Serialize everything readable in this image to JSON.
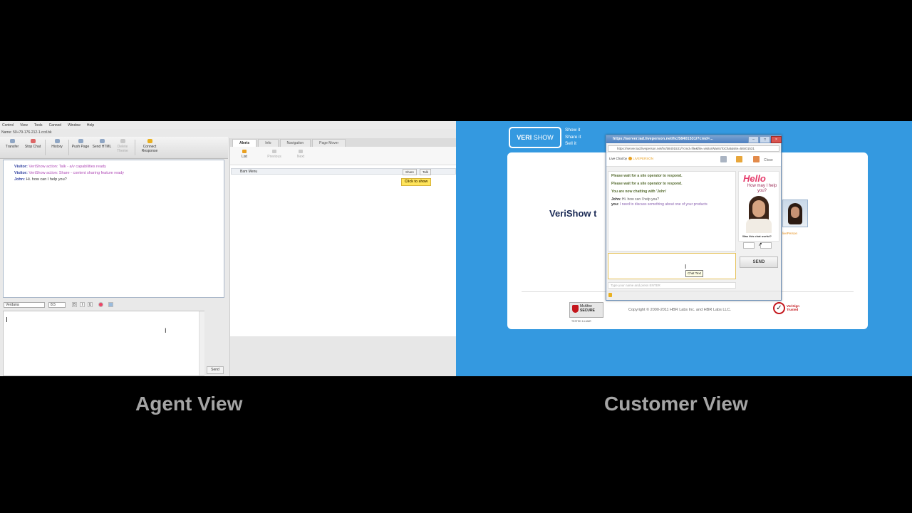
{
  "agent": {
    "menu": [
      "Control",
      "View",
      "Tools",
      "Canned",
      "Window",
      "Help"
    ],
    "name_line": "Name: 50+79-176-212-1.ccd.bk",
    "toolbar": [
      {
        "label": "Transfer",
        "enabled": true
      },
      {
        "label": "Stop Chat",
        "enabled": true
      },
      {
        "label": "History",
        "enabled": true
      },
      {
        "label": "Push Page",
        "enabled": true
      },
      {
        "label": "Send HTML",
        "enabled": true
      },
      {
        "label": "Delete Theme",
        "enabled": false
      },
      {
        "label": "Connect Response",
        "enabled": true
      }
    ],
    "chat": [
      {
        "who": "Visitor:",
        "text": "VeriShow action: Talk - a/v capabilities ready"
      },
      {
        "who": "Visitor:",
        "text": "VeriShow action: Share - content sharing feature ready"
      },
      {
        "who": "John:",
        "text": "Hi. how can I help you?"
      }
    ],
    "format": {
      "font": "Verdana",
      "size": "8.5"
    },
    "send_label": "Send",
    "right_tabs": [
      "Alerts",
      "Info",
      "Navigation",
      "Page Mover"
    ],
    "alert_buttons": [
      {
        "label": "List",
        "enabled": true
      },
      {
        "label": "Previous",
        "enabled": false
      },
      {
        "label": "Next",
        "enabled": false
      }
    ],
    "alert_row": {
      "label": "Bam Menu",
      "share_btn": "Share",
      "talk_btn": "Talk"
    },
    "click_to_show": "Click to show"
  },
  "customer": {
    "logo_left": "VERI",
    "logo_right": "SHOW",
    "tagline": [
      "Show it",
      "Share it",
      "Sell it"
    ],
    "card_title": "VeriShow t",
    "copyright": "Copyright © 2000-2011 HBR Labs Inc. and HBR Labs LLC.",
    "mcafee": {
      "brand": "McAfee",
      "label": "SECURE",
      "sub": "TESTED 14-MAR"
    },
    "verisign": {
      "line1": "VeriSign",
      "line2": "Trusted"
    },
    "side_avatar_label": "livePerson",
    "popup": {
      "title": "https://server.iad.liveperson.net/hc/58401531/?cmd=...",
      "url": "https://server.iad.liveperson.net/hc/58401531/?cmd=file&file=visitorWantsToChat&site=58401531",
      "live_chat_prefix": "Live Chat by",
      "live_chat_brand": "LIVEPERSON",
      "close_label": "Close",
      "messages": [
        {
          "type": "sys",
          "text": "Please wait for a site operator to respond."
        },
        {
          "type": "sys",
          "text": "Please wait for a site operator to respond."
        },
        {
          "type": "sys",
          "text": "You are now chatting with 'John'"
        },
        {
          "type": "john",
          "who": "John:",
          "text": "Hi. how can I help you?"
        },
        {
          "type": "you",
          "who": "you:",
          "text": "I need to discuss something about one of your products"
        }
      ],
      "hello_big": "Hello",
      "hello_small": "How may I help you?",
      "rate_caption": "Was this chat useful?",
      "send_label": "SEND",
      "tooltip": "Chat Text",
      "type_hint": "Type your name and press ENTER"
    }
  },
  "captions": {
    "agent": "Agent View",
    "customer": "Customer View"
  }
}
